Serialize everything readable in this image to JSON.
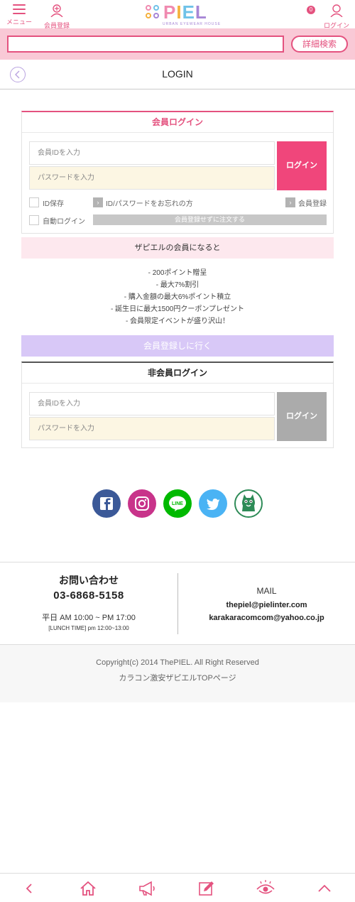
{
  "header": {
    "menu_label": "メニュー",
    "register_label": "会員登録",
    "logo_text": "PIEL",
    "logo_sub": "URBAN EYEWEAR HOUSE",
    "cart_count": "0",
    "login_label": "ログイン"
  },
  "search": {
    "value": "",
    "button_label": "詳細検索"
  },
  "page": {
    "title": "LOGIN"
  },
  "member_login": {
    "heading": "会員ログイン",
    "id_placeholder": "会員IDを入力",
    "pw_placeholder": "パスワードを入力",
    "login_button": "ログイン",
    "save_id_label": "ID保存",
    "forgot_label": "ID/パスワードをお忘れの方",
    "register_label": "会員登録",
    "auto_login_label": "自動ログイン",
    "guest_order_label": "会員登録せずに注文する"
  },
  "benefits": {
    "heading": "ザピエルの会員になると",
    "items": [
      "- 200ポイント贈呈",
      "- 最大7%割引",
      "- 購入金額の最大6%ポイント積立",
      "- 誕生日に最大1500円クーポンプレゼント",
      "- 会員限定イベントが盛り沢山！"
    ],
    "join_button": "会員登録しに行く"
  },
  "guest_login": {
    "heading": "非会員ログイン",
    "id_placeholder": "会員IDを入力",
    "pw_placeholder": "パスワードを入力",
    "login_button": "ログイン"
  },
  "social": {
    "icons": [
      "facebook-icon",
      "instagram-icon",
      "line-icon",
      "twitter-icon",
      "mascot-icon"
    ],
    "colors": {
      "facebook": "#3b5998",
      "instagram": "#c8338a",
      "line": "#00b900",
      "twitter": "#4ab3f4",
      "mascot": "#2e8b57"
    }
  },
  "contact": {
    "title": "お問い合わせ",
    "phone": "03-6868-5158",
    "hours": "平日 AM 10:00 ~ PM 17:00",
    "lunch": "[LUNCH TIME] pm 12:00~13:00",
    "mail_title": "MAIL",
    "mail_1": "thepiel@pielinter.com",
    "mail_2": "karakaracomcom@yahoo.co.jp"
  },
  "footer": {
    "copyright": "Copyright(c) 2014 ThePIEL. All Right Reserved",
    "top_link": "カラコン激安ザピエルTOPページ"
  },
  "bottom_nav": {
    "items": [
      "back-icon",
      "home-icon",
      "megaphone-icon",
      "edit-icon",
      "eye-icon",
      "scroll-top-icon"
    ]
  },
  "colors": {
    "accent": "#e4527f",
    "search_bg": "#f9c9d6",
    "join_bg": "#d8c8f7",
    "login_pink": "#f0467b"
  }
}
